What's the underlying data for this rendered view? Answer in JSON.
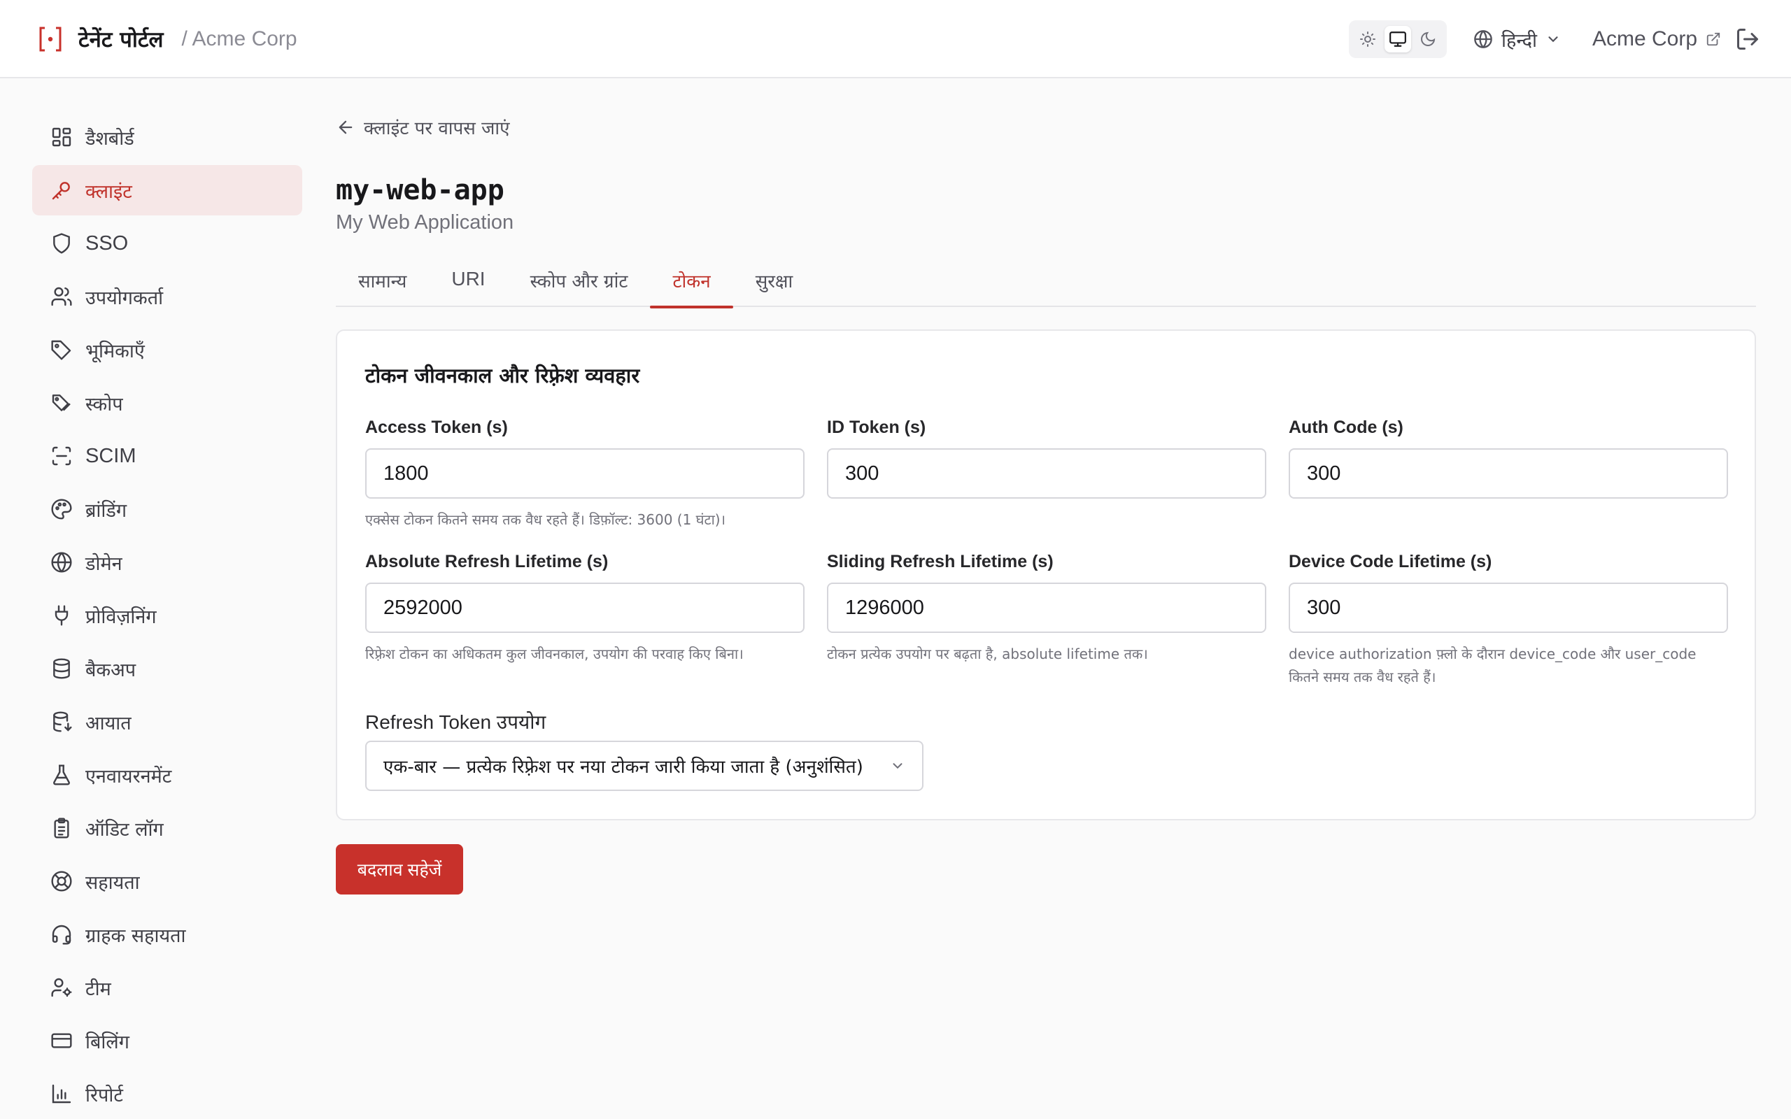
{
  "header": {
    "brand_title": "टेनेंट पोर्टल",
    "breadcrumb_org": "/ Acme Corp",
    "theme_modes": [
      "light",
      "system",
      "dark"
    ],
    "theme_selected": "system",
    "language": "हिन्दी",
    "org_link": "Acme Corp"
  },
  "sidebar": {
    "items": [
      {
        "label": "डैशबोर्ड",
        "icon": "dashboard-icon"
      },
      {
        "label": "क्लाइंट",
        "icon": "key-icon",
        "active": true
      },
      {
        "label": "SSO",
        "icon": "shield-icon"
      },
      {
        "label": "उपयोगकर्ता",
        "icon": "users-icon"
      },
      {
        "label": "भूमिकाएँ",
        "icon": "tag-icon"
      },
      {
        "label": "स्कोप",
        "icon": "tags-icon"
      },
      {
        "label": "SCIM",
        "icon": "scan-icon"
      },
      {
        "label": "ब्रांडिंग",
        "icon": "palette-icon"
      },
      {
        "label": "डोमेन",
        "icon": "globe-icon"
      },
      {
        "label": "प्रोविज़निंग",
        "icon": "plug-icon"
      },
      {
        "label": "बैकअप",
        "icon": "database-icon"
      },
      {
        "label": "आयात",
        "icon": "database-import-icon"
      },
      {
        "label": "एनवायरनमेंट",
        "icon": "flask-icon"
      },
      {
        "label": "ऑडिट लॉग",
        "icon": "clipboard-icon"
      },
      {
        "label": "सहायता",
        "icon": "lifebuoy-icon"
      },
      {
        "label": "ग्राहक सहायता",
        "icon": "headset-icon"
      },
      {
        "label": "टीम",
        "icon": "user-cog-icon"
      },
      {
        "label": "बिलिंग",
        "icon": "credit-card-icon"
      },
      {
        "label": "रिपोर्ट",
        "icon": "bar-chart-icon"
      }
    ]
  },
  "main": {
    "back_label": "क्लाइंट पर वापस जाएं",
    "app_title": "my-web-app",
    "app_subtitle": "My Web Application",
    "tabs": [
      {
        "label": "सामान्य"
      },
      {
        "label": "URI"
      },
      {
        "label": "स्कोप और ग्रांट"
      },
      {
        "label": "टोकन",
        "active": true
      },
      {
        "label": "सुरक्षा"
      }
    ],
    "card": {
      "title": "टोकन जीवनकाल और रिफ़्रेश व्यवहार",
      "fields": [
        {
          "label": "Access Token (s)",
          "value": "1800",
          "help": "एक्सेस टोकन कितने समय तक वैध रहते हैं। डिफ़ॉल्ट: 3600 (1 घंटा)।"
        },
        {
          "label": "ID Token (s)",
          "value": "300",
          "help": ""
        },
        {
          "label": "Auth Code (s)",
          "value": "300",
          "help": ""
        },
        {
          "label": "Absolute Refresh Lifetime (s)",
          "value": "2592000",
          "help": "रिफ़्रेश टोकन का अधिकतम कुल जीवनकाल, उपयोग की परवाह किए बिना।"
        },
        {
          "label": "Sliding Refresh Lifetime (s)",
          "value": "1296000",
          "help": "टोकन प्रत्येक उपयोग पर बढ़ता है, absolute lifetime तक।"
        },
        {
          "label": "Device Code Lifetime (s)",
          "value": "300",
          "help": "device authorization फ़्लो के दौरान device_code और user_code कितने समय तक वैध रहते हैं।"
        }
      ],
      "refresh_usage_label": "Refresh Token उपयोग",
      "refresh_usage_value": "एक-बार — प्रत्येक रिफ़्रेश पर नया टोकन जारी किया जाता है (अनुशंसित)"
    },
    "save_label": "बदलाव सहेजें"
  },
  "colors": {
    "accent": "#c8312b",
    "active_nav_bg": "#f6e7e7"
  }
}
